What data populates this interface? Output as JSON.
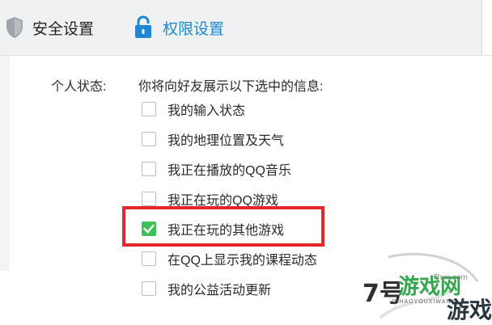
{
  "tabs": [
    {
      "label": "安全设置",
      "icon": "shield-icon"
    },
    {
      "label": "权限设置",
      "icon": "lock-icon",
      "active": true
    }
  ],
  "status": {
    "label": "个人状态:",
    "hint": "你将向好友展示以下选中的信息:"
  },
  "options": [
    {
      "label": "我的输入状态",
      "checked": false
    },
    {
      "label": "我的地理位置及天气",
      "checked": false
    },
    {
      "label": "我正在播放的QQ音乐",
      "checked": false
    },
    {
      "label": "我正在玩的QQ游戏",
      "checked": false
    },
    {
      "label": "我正在玩的其他游戏",
      "checked": true
    },
    {
      "label": "在QQ上显示我的课程动态",
      "checked": false
    },
    {
      "label": "我的公益活动更新",
      "checked": false
    }
  ],
  "watermark": {
    "seven": "7号",
    "game1": "游戏网",
    "sub": "QIHAOYOUXIWANG",
    "game2": "游戏",
    "url": "7hyx.com"
  },
  "colors": {
    "accent": "#1e88d6",
    "check": "#3fbe5a",
    "highlight": "#e5262d"
  }
}
